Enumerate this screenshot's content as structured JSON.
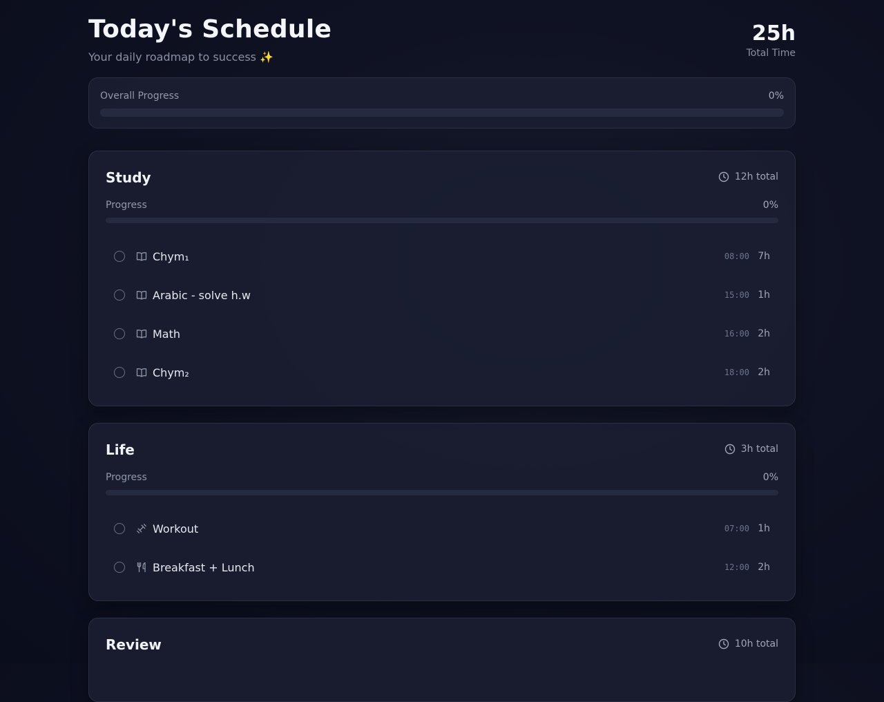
{
  "header": {
    "title": "Today's Schedule",
    "subtitle": "Your daily roadmap to success ✨",
    "total_value": "25h",
    "total_label": "Total Time"
  },
  "overall": {
    "label": "Overall Progress",
    "percent_text": "0%",
    "percent": 0
  },
  "colors": {
    "background": "#0f1222",
    "card": "#1b1e31",
    "border": "#2a2f45",
    "track": "#262a3e",
    "accent": "#5b6cff"
  },
  "sections": [
    {
      "title": "Study",
      "total": "12h total",
      "progress_label": "Progress",
      "percent_text": "0%",
      "percent": 0,
      "tasks": [
        {
          "icon": "book-icon",
          "name": "Chym₁",
          "time": "08:00",
          "duration": "7h"
        },
        {
          "icon": "book-icon",
          "name": "Arabic - solve h.w",
          "time": "15:00",
          "duration": "1h"
        },
        {
          "icon": "book-icon",
          "name": "Math",
          "time": "16:00",
          "duration": "2h"
        },
        {
          "icon": "book-icon",
          "name": "Chym₂",
          "time": "18:00",
          "duration": "2h"
        }
      ]
    },
    {
      "title": "Life",
      "total": "3h total",
      "progress_label": "Progress",
      "percent_text": "0%",
      "percent": 0,
      "tasks": [
        {
          "icon": "dumbbell-icon",
          "name": "Workout",
          "time": "07:00",
          "duration": "1h"
        },
        {
          "icon": "utensils-icon",
          "name": "Breakfast + Lunch",
          "time": "12:00",
          "duration": "2h"
        }
      ]
    },
    {
      "title": "Review",
      "total": "10h total"
    }
  ]
}
